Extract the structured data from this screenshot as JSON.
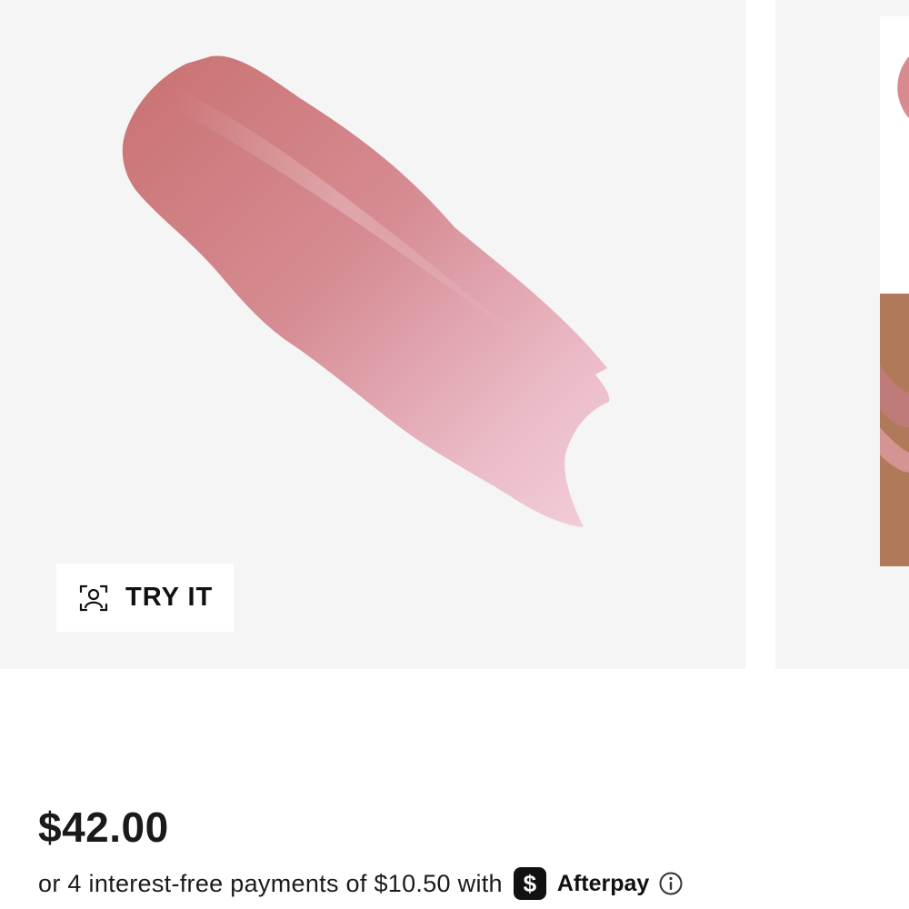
{
  "product_gallery": {
    "main_image": {
      "alt_icon": "lipstick-swatch-image",
      "swatch_color_dark": "#c97575",
      "swatch_color_light": "#efc8d2",
      "background": "#f5f5f5"
    },
    "try_it_button": {
      "label": "TRY IT",
      "icon": "face-scan-icon"
    },
    "second_image": {
      "alt_icon": "lips-model-image"
    }
  },
  "pricing": {
    "price": "$42.00",
    "installments_text": "or 4 interest-free payments of $10.50 with",
    "afterpay_mark": "$",
    "afterpay_name": "Afterpay",
    "info_icon": "info-icon"
  }
}
